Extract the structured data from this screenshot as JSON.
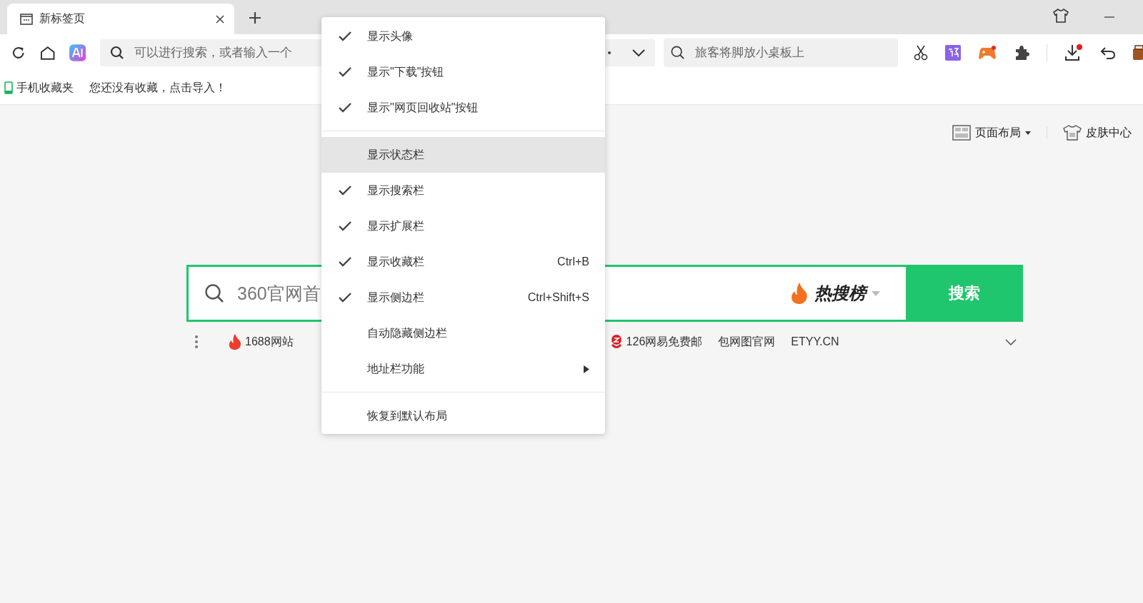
{
  "tab": {
    "title": "新标签页",
    "selected": true
  },
  "address_bar": {
    "placeholder": "可以进行搜索，或者输入一个"
  },
  "side_search": {
    "placeholder": "旅客将脚放小桌板上"
  },
  "bookmarks": [
    {
      "label": "手机收藏夹"
    },
    {
      "label": "您还没有收藏，点击导入！"
    }
  ],
  "page_tools": [
    {
      "label": "页面布局",
      "kind": "layout"
    },
    {
      "label": "皮肤中心",
      "kind": "skin"
    }
  ],
  "main_search": {
    "placeholder": "360官网首",
    "hot_label": "热搜榜",
    "button": "搜索"
  },
  "quick_links": [
    {
      "label": "1688网站",
      "kind": "fire"
    },
    {
      "label": "126网易免费邮",
      "kind": "mail"
    },
    {
      "label": "包网图官网",
      "kind": "plain"
    },
    {
      "label": "ETYY.CN",
      "kind": "plain"
    }
  ],
  "menu": [
    {
      "kind": "item",
      "label": "显示头像",
      "checked": true,
      "selected": false
    },
    {
      "kind": "item",
      "label": "显示\"下载\"按钮",
      "checked": true,
      "selected": false
    },
    {
      "kind": "item",
      "label": "显示\"网页回收站\"按钮",
      "checked": true,
      "selected": false
    },
    {
      "kind": "separator"
    },
    {
      "kind": "item",
      "label": "显示状态栏",
      "checked": false,
      "selected": true
    },
    {
      "kind": "item",
      "label": "显示搜索栏",
      "checked": true,
      "selected": false
    },
    {
      "kind": "item",
      "label": "显示扩展栏",
      "checked": true,
      "selected": false
    },
    {
      "kind": "item",
      "label": "显示收藏栏",
      "checked": true,
      "selected": false,
      "shortcut": "Ctrl+B"
    },
    {
      "kind": "item",
      "label": "显示侧边栏",
      "checked": true,
      "selected": false,
      "shortcut": "Ctrl+Shift+S"
    },
    {
      "kind": "item",
      "label": "自动隐藏侧边栏",
      "checked": false,
      "selected": false
    },
    {
      "kind": "submenu",
      "label": "地址栏功能",
      "checked": false,
      "selected": false
    },
    {
      "kind": "separator"
    },
    {
      "kind": "item",
      "label": "恢复到默认布局",
      "checked": false,
      "selected": false
    }
  ]
}
